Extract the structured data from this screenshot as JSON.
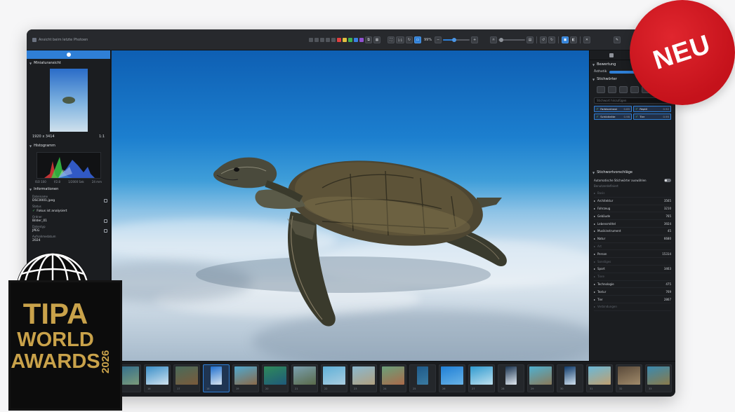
{
  "window": {
    "title": "Ansicht beim letzte Photoen"
  },
  "toolbar": {
    "ratio_label": "1:1",
    "zoom_value": "99%",
    "zoom_fraction": 0.42,
    "exposure_fraction": 0.1,
    "color_labels": [
      "#e04040",
      "#e0c040",
      "#40b050",
      "#3a80e0",
      "#9050d0"
    ]
  },
  "left_panel": {
    "thumbnail_header": "Miniaturansicht",
    "dimensions": "1920 x 3414",
    "ratio": "1:1",
    "histogram_header": "Histogramm",
    "histogram_labels": [
      "ISO 100",
      "f/2.8",
      "1/2000 Sek",
      "24 mm"
    ],
    "info_header": "Informationen",
    "info": [
      {
        "label": "Dateiname",
        "value": "DSC0001.jpeg"
      },
      {
        "label": "Status",
        "value": "Fokus ist analysiert"
      },
      {
        "label": "Ordner",
        "value": "Bilder_01"
      },
      {
        "label": "Datentyp",
        "value": "JPEG"
      },
      {
        "label": "Aufnahmedatum",
        "value": "2024"
      }
    ]
  },
  "right_panel": {
    "rating_header": "Bewertung",
    "rating_label": "Ästhetik",
    "rating_fraction": 0.85,
    "keywords_header": "Stichwörter",
    "keywords_placeholder": "Stichwort hinzufügen",
    "chips": [
      {
        "name": "Farbkontrast",
        "score": "0.85"
      },
      {
        "name": "Reptil",
        "score": "0.92"
      },
      {
        "name": "Schildkröte",
        "score": "0.98"
      },
      {
        "name": "Tier",
        "score": "0.95"
      }
    ],
    "suggestions_header": "Stichwortvorschläge",
    "auto_toggle_label": "Automatische Stichwörter auswählen",
    "sub_label": "Benutzerdefiniert",
    "categories": [
      {
        "name": "Basis",
        "count": "",
        "dim": true
      },
      {
        "name": "Architektur",
        "count": "3565",
        "dim": false
      },
      {
        "name": "Fahrzeug",
        "count": "3210",
        "dim": false
      },
      {
        "name": "Gebäude",
        "count": "765",
        "dim": false
      },
      {
        "name": "Lebensmittel",
        "count": "3924",
        "dim": false
      },
      {
        "name": "Musikinstrument",
        "count": "45",
        "dim": false
      },
      {
        "name": "Natur",
        "count": "6680",
        "dim": false
      },
      {
        "name": "Art",
        "count": "",
        "dim": true
      },
      {
        "name": "Person",
        "count": "15314",
        "dim": false
      },
      {
        "name": "Sonstiges",
        "count": "",
        "dim": true
      },
      {
        "name": "Sport",
        "count": "3463",
        "dim": false
      },
      {
        "name": "Tiere",
        "count": "",
        "dim": true
      },
      {
        "name": "Technologie",
        "count": "475",
        "dim": false
      },
      {
        "name": "Textur",
        "count": "769",
        "dim": false
      },
      {
        "name": "Tier",
        "count": "2867",
        "dim": false
      },
      {
        "name": "Verbindungen",
        "count": "",
        "dim": true
      }
    ]
  },
  "filmstrip": {
    "frames": [
      {
        "label": "15",
        "colors": [
          "#2f6c8e",
          "#7a9a7a"
        ],
        "portrait": false,
        "selected": false
      },
      {
        "label": "16",
        "colors": [
          "#3a8fc9",
          "#cfe2ee"
        ],
        "portrait": false,
        "selected": false
      },
      {
        "label": "17",
        "colors": [
          "#4a6b5a",
          "#7a5a3a"
        ],
        "portrait": false,
        "selected": false
      },
      {
        "label": "18",
        "colors": [
          "#1f6fcf",
          "#d8e4ee"
        ],
        "portrait": true,
        "selected": true
      },
      {
        "label": "19",
        "colors": [
          "#4fa8cf",
          "#8a6a4a"
        ],
        "portrait": false,
        "selected": false
      },
      {
        "label": "20",
        "colors": [
          "#2f8a5a",
          "#1f5a7a"
        ],
        "portrait": false,
        "selected": false
      },
      {
        "label": "21",
        "colors": [
          "#7aa0b0",
          "#5a6a4a"
        ],
        "portrait": false,
        "selected": false
      },
      {
        "label": "22",
        "colors": [
          "#5fb0d8",
          "#aacde0"
        ],
        "portrait": false,
        "selected": false
      },
      {
        "label": "23",
        "colors": [
          "#8ab8cf",
          "#b0a080"
        ],
        "portrait": false,
        "selected": false
      },
      {
        "label": "24",
        "colors": [
          "#6aa07a",
          "#aa6a4a"
        ],
        "portrait": false,
        "selected": false
      },
      {
        "label": "25",
        "colors": [
          "#1e5a8a",
          "#3a7aa0"
        ],
        "portrait": true,
        "selected": false
      },
      {
        "label": "26",
        "colors": [
          "#1f7fd6",
          "#69b3e6"
        ],
        "portrait": false,
        "selected": false
      },
      {
        "label": "27",
        "colors": [
          "#2f9ad0",
          "#bde0ee"
        ],
        "portrait": false,
        "selected": false
      },
      {
        "label": "28",
        "colors": [
          "#1b3450",
          "#e0e8f0"
        ],
        "portrait": true,
        "selected": false
      },
      {
        "label": "29",
        "colors": [
          "#4fb0d0",
          "#8a7a5a"
        ],
        "portrait": false,
        "selected": false
      },
      {
        "label": "30",
        "colors": [
          "#0f3a6a",
          "#cfe0ee"
        ],
        "portrait": true,
        "selected": false
      },
      {
        "label": "31",
        "colors": [
          "#6ab8d8",
          "#c0a070"
        ],
        "portrait": false,
        "selected": false
      },
      {
        "label": "32",
        "colors": [
          "#5a4a3a",
          "#a08a6a"
        ],
        "portrait": false,
        "selected": false
      },
      {
        "label": "33",
        "colors": [
          "#3a8ab0",
          "#8a7a4a"
        ],
        "portrait": false,
        "selected": false
      }
    ]
  },
  "badge": {
    "text": "NEU",
    "color": "#d41820"
  },
  "award": {
    "line1": "TIPA",
    "line2": "WORLD",
    "line3": "AWARDS",
    "year": "2026",
    "gold": "#c9a24a"
  }
}
